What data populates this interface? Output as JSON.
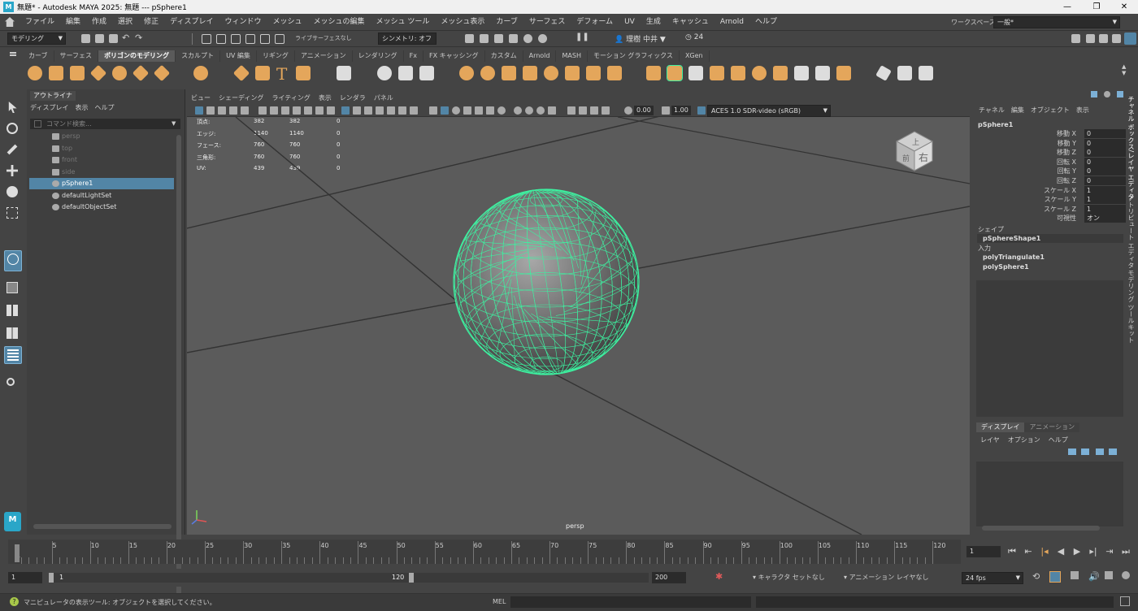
{
  "window": {
    "title": "無題* - Autodesk MAYA 2025: 無題   ---   pSphere1",
    "app_badge": "M"
  },
  "menu": [
    "ファイル",
    "編集",
    "作成",
    "選択",
    "修正",
    "ディスプレイ",
    "ウィンドウ",
    "メッシュ",
    "メッシュの編集",
    "メッシュ ツール",
    "メッシュ表示",
    "カーブ",
    "サーフェス",
    "デフォーム",
    "UV",
    "生成",
    "キャッシュ",
    "Arnold",
    "ヘルプ"
  ],
  "workspace": {
    "label": "ワークスペース:",
    "value": "一般*"
  },
  "status": {
    "mode": "モデリング",
    "live_label": "ライブ",
    "live_value": "サーフェスなし",
    "symmetry": "シンメトリ: オフ",
    "user": "理樹 中井",
    "credits": "24"
  },
  "shelf_tabs": [
    "カーブ",
    "サーフェス",
    "ポリゴンのモデリング",
    "スカルプト",
    "UV 編集",
    "リギング",
    "アニメーション",
    "レンダリング",
    "Fx",
    "FX キャッシング",
    "カスタム",
    "Arnold",
    "MASH",
    "モーション グラフィックス",
    "XGen"
  ],
  "shelf_active": "ポリゴンのモデリング",
  "outliner": {
    "tab": "アウトライナ",
    "menu": [
      "ディスプレイ",
      "表示",
      "ヘルプ"
    ],
    "search_placeholder": "コマンド検索...",
    "items": [
      {
        "label": "persp",
        "state": "dim"
      },
      {
        "label": "top",
        "state": "dim"
      },
      {
        "label": "front",
        "state": "dim"
      },
      {
        "label": "side",
        "state": "dim"
      },
      {
        "label": "pSphere1",
        "state": "selected"
      },
      {
        "label": "defaultLightSet",
        "state": "normal"
      },
      {
        "label": "defaultObjectSet",
        "state": "normal"
      }
    ]
  },
  "viewport": {
    "menu": [
      "ビュー",
      "シェーディング",
      "ライティング",
      "表示",
      "レンダラ",
      "パネル"
    ],
    "exposure": "0.00",
    "gamma": "1.00",
    "colorspace": "ACES 1.0 SDR-video (sRGB)",
    "camera_label": "persp",
    "viewcube_top": "上",
    "viewcube_front": "前",
    "viewcube_right": "右",
    "hud": [
      {
        "label": "頂点:",
        "a": "382",
        "b": "382",
        "c": "0"
      },
      {
        "label": "エッジ:",
        "a": "1140",
        "b": "1140",
        "c": "0"
      },
      {
        "label": "フェース:",
        "a": "760",
        "b": "760",
        "c": "0"
      },
      {
        "label": "三角形:",
        "a": "760",
        "b": "760",
        "c": "0"
      },
      {
        "label": "UV:",
        "a": "439",
        "b": "439",
        "c": "0"
      }
    ]
  },
  "channelbox": {
    "menu": [
      "チャネル",
      "編集",
      "オブジェクト",
      "表示"
    ],
    "object": "pSphere1",
    "attrs": [
      {
        "label": "移動 X",
        "value": "0"
      },
      {
        "label": "移動 Y",
        "value": "0"
      },
      {
        "label": "移動 Z",
        "value": "0"
      },
      {
        "label": "回転 X",
        "value": "0"
      },
      {
        "label": "回転 Y",
        "value": "0"
      },
      {
        "label": "回転 Z",
        "value": "0"
      },
      {
        "label": "スケール X",
        "value": "1"
      },
      {
        "label": "スケール Y",
        "value": "1"
      },
      {
        "label": "スケール Z",
        "value": "1"
      },
      {
        "label": "可視性",
        "value": "オン"
      }
    ],
    "shapes_label": "シェイプ",
    "shape": "pSphereShape1",
    "inputs_label": "入力",
    "inputs": [
      "polyTriangulate1",
      "polySphere1"
    ]
  },
  "layers": {
    "tabs": [
      "ディスプレイ",
      "アニメーション"
    ],
    "menu": [
      "レイヤ",
      "オプション",
      "ヘルプ"
    ]
  },
  "side_tabs": [
    "チャネル ボックス/レイヤ エディタ",
    "アトリビュート エディタ",
    "モデリング ツールキット"
  ],
  "time": {
    "ticks": [
      "5",
      "10",
      "15",
      "20",
      "25",
      "30",
      "35",
      "40",
      "45",
      "50",
      "55",
      "60",
      "65",
      "70",
      "75",
      "80",
      "85",
      "90",
      "95",
      "100",
      "105",
      "110",
      "115",
      "120"
    ],
    "start_tick": "1",
    "current": "1",
    "range_start": "1",
    "range_inner_start": "1",
    "range_inner_end": "120",
    "range_end": "200",
    "character": "キャラクタ セットなし",
    "anim_layer": "アニメーション レイヤなし",
    "fps": "24 fps"
  },
  "helpline": {
    "text": "マニピュレータの表示ツール: オブジェクトを選択してください。",
    "mel_label": "MEL"
  },
  "colors": {
    "accent": "#5285a6",
    "wire": "#3ef0a0",
    "shelf_icon": "#e4a65b"
  }
}
